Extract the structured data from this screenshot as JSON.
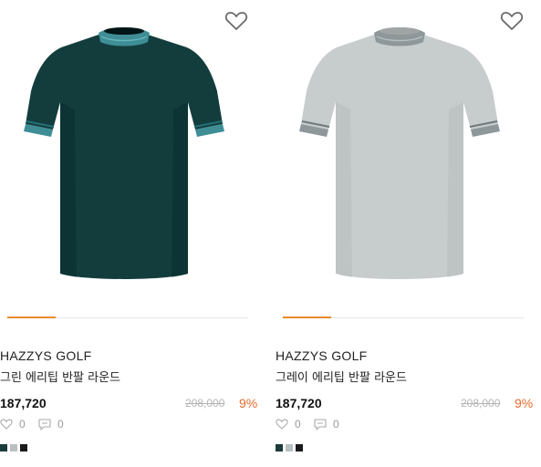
{
  "products": [
    {
      "brand": "HAZZYS GOLF",
      "name": "그린 에리팁 반팔 라운드",
      "price": "187,720",
      "original_price": "208,000",
      "discount": "9%",
      "likes": "0",
      "reviews": "0",
      "image_progress": 0.2,
      "shirt_color": "#133d3d",
      "trim_color": "#3f8e96",
      "swatches": [
        "#1c3b3b",
        "#b8c0c2",
        "#1a1a1a"
      ]
    },
    {
      "brand": "HAZZYS GOLF",
      "name": "그레이 에리팁 반팔 라운드",
      "price": "187,720",
      "original_price": "208,000",
      "discount": "9%",
      "likes": "0",
      "reviews": "0",
      "image_progress": 0.2,
      "shirt_color": "#c7cccd",
      "trim_color": "#8e9799",
      "swatches": [
        "#1c3b3b",
        "#b8c0c2",
        "#1a1a1a"
      ]
    }
  ],
  "icons": {
    "wishlist": "heart-outline-icon",
    "like": "heart-outline-icon",
    "review": "speech-bubble-icon"
  },
  "colors": {
    "accent": "#e98a2b",
    "discount": "#e9692c"
  }
}
